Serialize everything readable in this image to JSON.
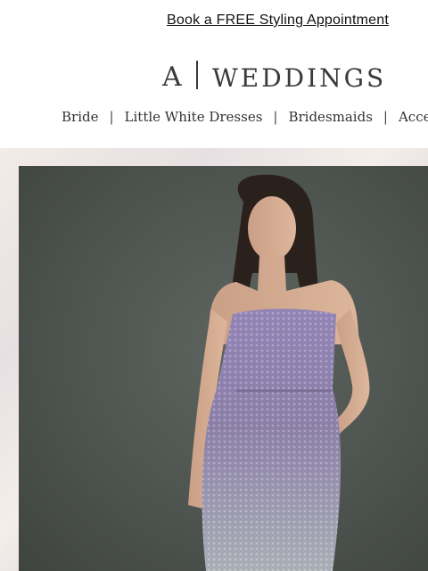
{
  "promo": {
    "text": "Book a FREE Styling Appointment"
  },
  "logo": {
    "letter": "A",
    "word": "WEDDINGS"
  },
  "nav": {
    "items": [
      {
        "label": "Bride"
      },
      {
        "label": "Little White Dresses"
      },
      {
        "label": "Bridesmaids"
      },
      {
        "label": "Accessories"
      }
    ],
    "separator": "|"
  },
  "hero": {
    "image": "model-in-sequin-strapless-dress",
    "colors": {
      "backdrop": "#4f5550",
      "dress": "#8a7aa8"
    }
  }
}
